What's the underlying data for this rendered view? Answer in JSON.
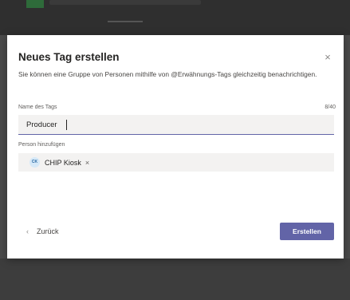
{
  "dialog": {
    "title": "Neues Tag erstellen",
    "close_glyph": "×",
    "description": "Sie können eine Gruppe von Personen mithilfe von @Erwähnungs-Tags gleichzeitig benachrichtigen."
  },
  "tag_name": {
    "label": "Name des Tags",
    "value": "Producer",
    "counter": "8/40"
  },
  "add_person": {
    "label": "Person hinzufügen",
    "chips": [
      {
        "initials": "CK",
        "name": "CHIP Kiosk",
        "remove_glyph": "×"
      }
    ]
  },
  "footer": {
    "back_glyph": "‹",
    "back_label": "Zurück",
    "create_label": "Erstellen"
  },
  "colors": {
    "accent": "#6264a7",
    "field_bg": "#f3f2f1"
  }
}
